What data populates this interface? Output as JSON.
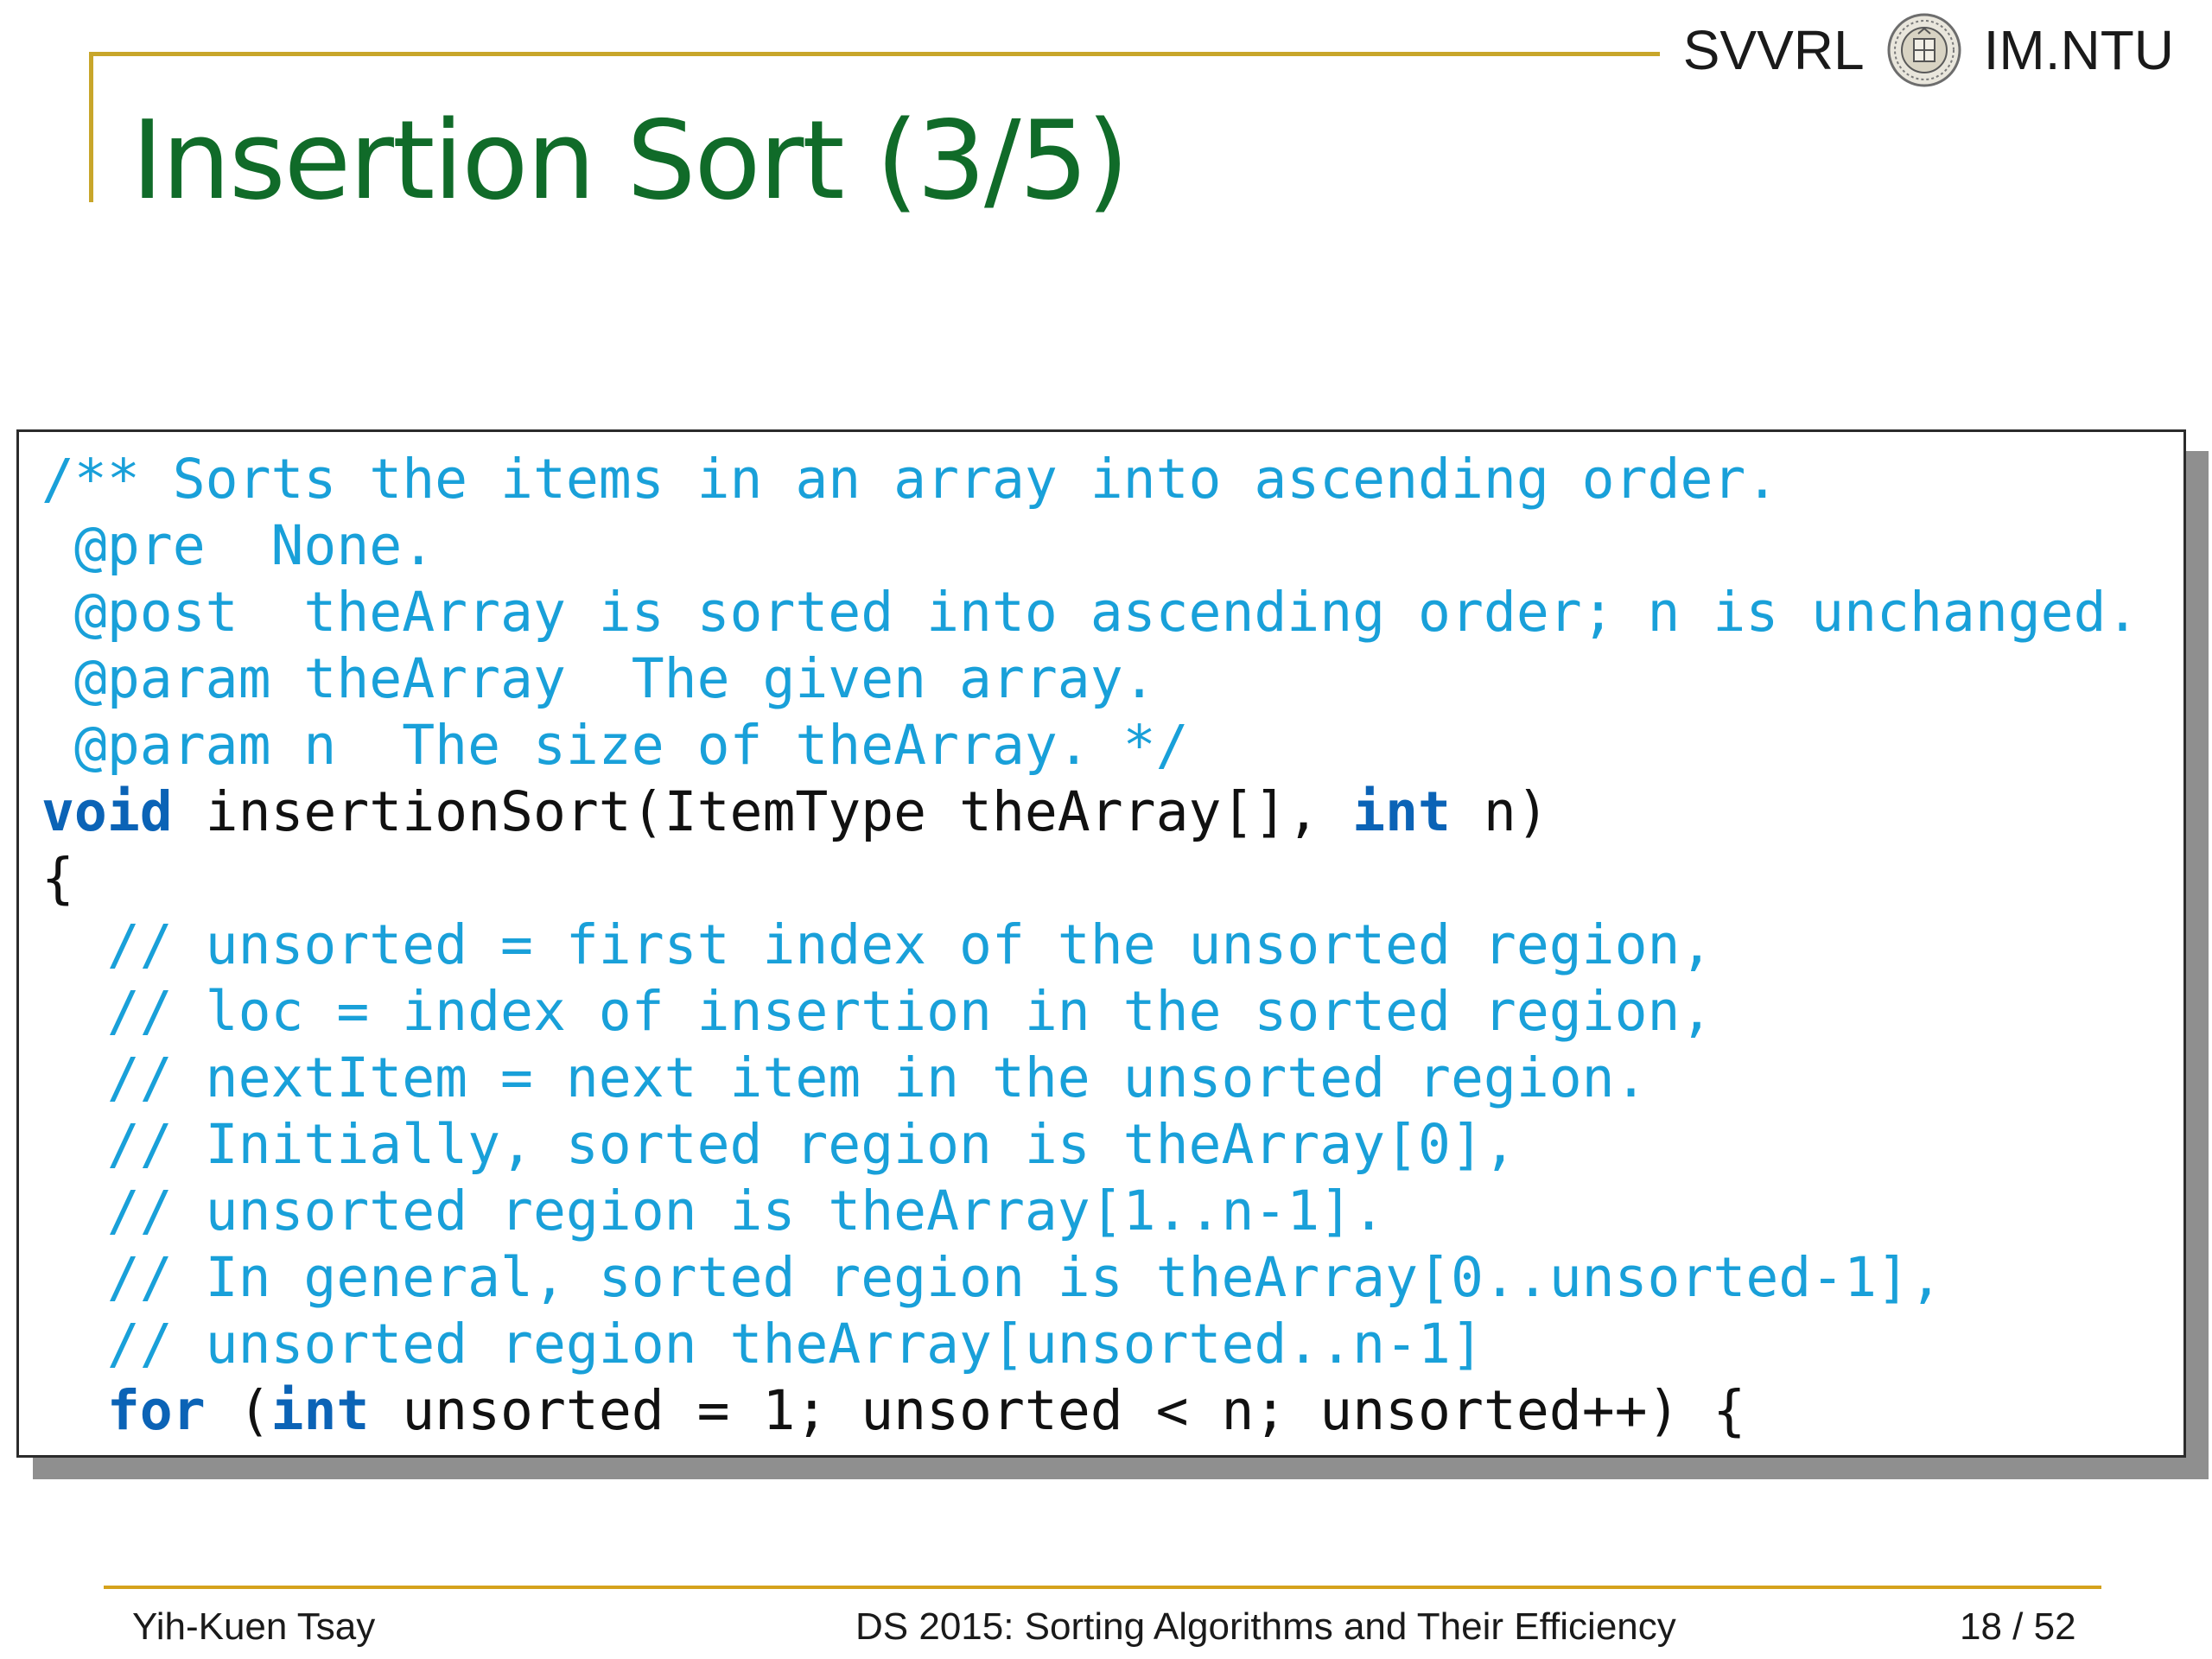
{
  "header": {
    "lab": "SVVRL",
    "dept": "IM.NTU",
    "logo_icon": "ntu-seal-icon"
  },
  "slide": {
    "title": "Insertion Sort (3/5)"
  },
  "code": {
    "lines": [
      [
        {
          "t": "/** Sorts the items in an array into ascending order.",
          "c": "cm"
        }
      ],
      [
        {
          "t": " @pre  None.",
          "c": "cm"
        }
      ],
      [
        {
          "t": " @post  theArray is sorted into ascending order; n is unchanged.",
          "c": "cm"
        }
      ],
      [
        {
          "t": " @param theArray  The given array.",
          "c": "cm"
        }
      ],
      [
        {
          "t": " @param n  The size of theArray. */",
          "c": "cm"
        }
      ],
      [
        {
          "t": "void",
          "c": "kw"
        },
        {
          "t": " insertionSort(ItemType theArray[], ",
          "c": "tx"
        },
        {
          "t": "int",
          "c": "kw"
        },
        {
          "t": " n)",
          "c": "tx"
        }
      ],
      [
        {
          "t": "{",
          "c": "tx"
        }
      ],
      [
        {
          "t": "  // unsorted = first index of the unsorted region,",
          "c": "cm"
        }
      ],
      [
        {
          "t": "  // loc = index of insertion in the sorted region,",
          "c": "cm"
        }
      ],
      [
        {
          "t": "  // nextItem = next item in the unsorted region.",
          "c": "cm"
        }
      ],
      [
        {
          "t": "  // Initially, sorted region is theArray[0],",
          "c": "cm"
        }
      ],
      [
        {
          "t": "  // unsorted region is theArray[1..n-1].",
          "c": "cm"
        }
      ],
      [
        {
          "t": "  // In general, sorted region is theArray[0..unsorted-1],",
          "c": "cm"
        }
      ],
      [
        {
          "t": "  // unsorted region theArray[unsorted..n-1]",
          "c": "cm"
        }
      ],
      [
        {
          "t": "  ",
          "c": "tx"
        },
        {
          "t": "for",
          "c": "kw"
        },
        {
          "t": " (",
          "c": "tx"
        },
        {
          "t": "int",
          "c": "kw"
        },
        {
          "t": " unsorted = 1; unsorted < n; unsorted++) {",
          "c": "tx"
        }
      ]
    ]
  },
  "footer": {
    "author": "Yih-Kuen Tsay",
    "course": "DS 2015: Sorting Algorithms and Their Efficiency",
    "page": "18 / 52"
  },
  "colors": {
    "title_green": "#106b29",
    "rule_gold": "#c8a62a",
    "comment_cyan": "#19a0d9",
    "keyword_blue": "#0b63b6"
  }
}
